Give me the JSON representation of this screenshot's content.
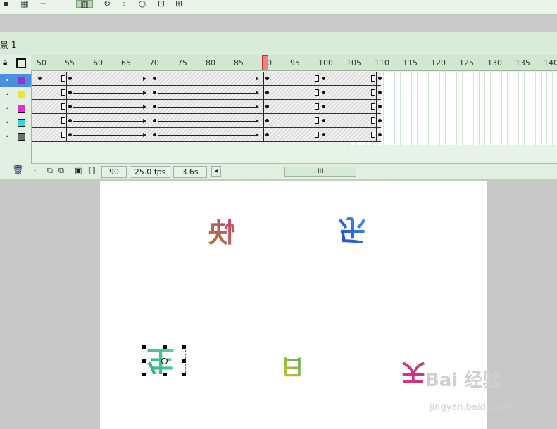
{
  "toolbar": {
    "icons": [
      "doc-icon",
      "layers-icon",
      "dash-icon",
      "grid-icon",
      "rotate-icon",
      "zoom-icon",
      "circle-icon",
      "align-icon",
      "transform-icon"
    ]
  },
  "scene": {
    "label": "景 1"
  },
  "ruler": {
    "ticks": [
      "50",
      "55",
      "60",
      "65",
      "70",
      "75",
      "80",
      "85",
      "90",
      "95",
      "100",
      "105",
      "110",
      "115",
      "120",
      "125",
      "130",
      "135",
      "140"
    ]
  },
  "layers": [
    {
      "color": "#9b30d0"
    },
    {
      "color": "#e8e830"
    },
    {
      "color": "#e030d0"
    },
    {
      "color": "#30d8e0"
    },
    {
      "color": "#707070"
    }
  ],
  "status": {
    "current_frame": "90",
    "fps": "25.0 fps",
    "time": "3.6s",
    "scroll_grip": "III"
  },
  "stage": {
    "characters": [
      {
        "char": "快",
        "colors": [
          "#d0407a",
          "#a08030"
        ]
      },
      {
        "char": "乐",
        "colors": [
          "#2040d0",
          "#40a0e0"
        ]
      },
      {
        "char": "生",
        "colors": [
          "#30b080",
          "#60d0a0"
        ]
      },
      {
        "char": "日",
        "colors": [
          "#e0c030",
          "#40b060"
        ]
      },
      {
        "char": "天",
        "colors": [
          "#e03090",
          "#b04070"
        ]
      }
    ]
  },
  "watermark": {
    "brand": "Bai 经验",
    "url": "jingyan.baidu.com"
  }
}
